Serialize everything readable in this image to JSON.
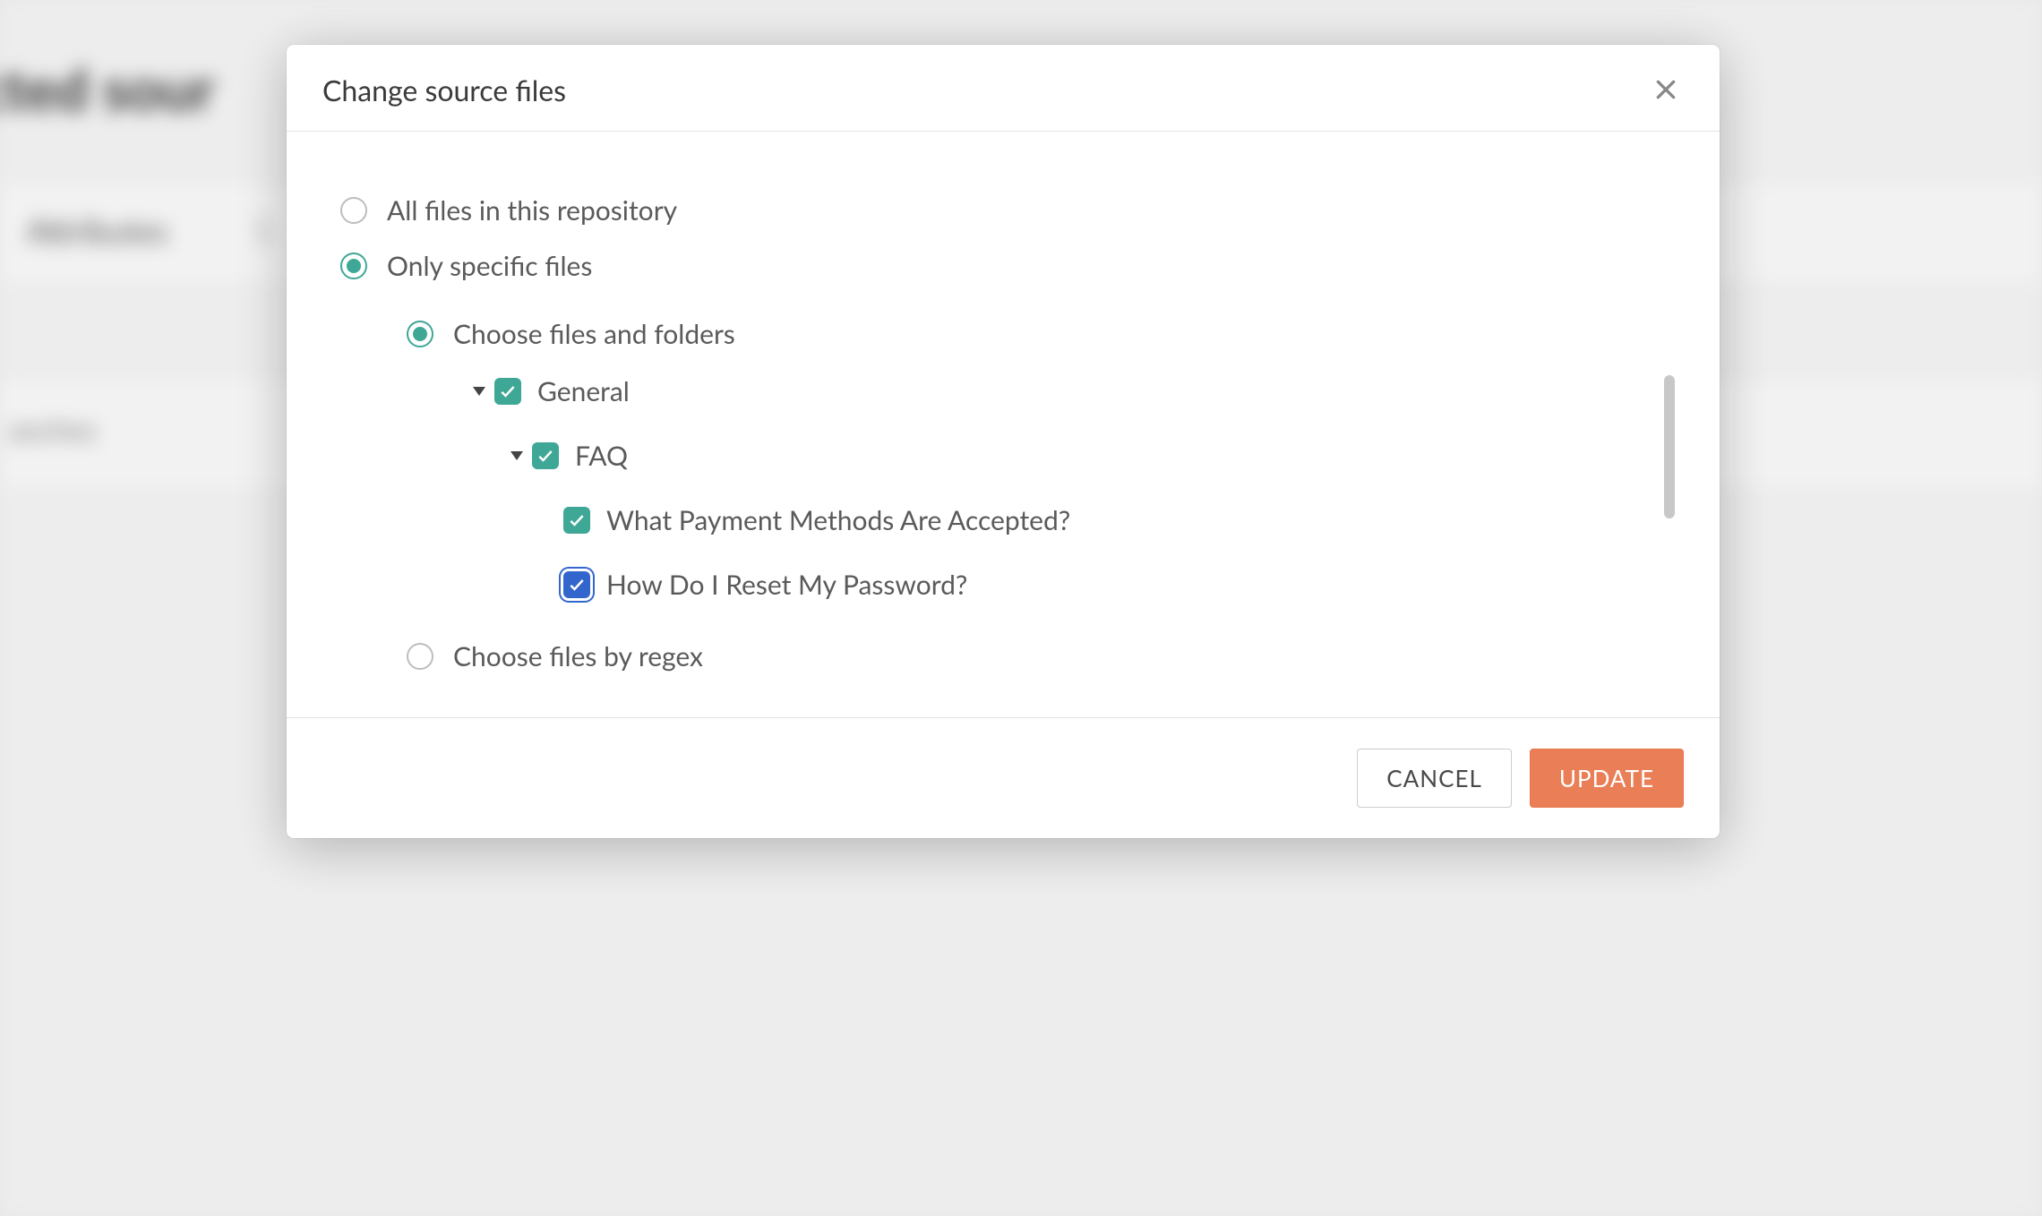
{
  "modal": {
    "title": "Change source files",
    "scope_options": {
      "all_files": {
        "label": "All files in this repository",
        "selected": false
      },
      "specific": {
        "label": "Only specific files",
        "selected": true
      }
    },
    "method_options": {
      "choose_tree": {
        "label": "Choose files and folders",
        "selected": true
      },
      "choose_regex": {
        "label": "Choose files by regex",
        "selected": false
      }
    },
    "tree": {
      "nodes": [
        {
          "level": 0,
          "expanded": true,
          "checked": true,
          "focused": false,
          "label": "General"
        },
        {
          "level": 1,
          "expanded": true,
          "checked": true,
          "focused": false,
          "label": "FAQ"
        },
        {
          "level": 2,
          "expanded": null,
          "checked": true,
          "focused": false,
          "label": "What Payment Methods Are Accepted?"
        },
        {
          "level": 2,
          "expanded": null,
          "checked": true,
          "focused": true,
          "label": "How Do I Reset My Password?"
        }
      ]
    },
    "buttons": {
      "cancel": "CANCEL",
      "update": "UPDATE"
    }
  },
  "colors": {
    "teal": "#3fa796",
    "orange": "#ea7f57",
    "blue": "#3366cc"
  }
}
